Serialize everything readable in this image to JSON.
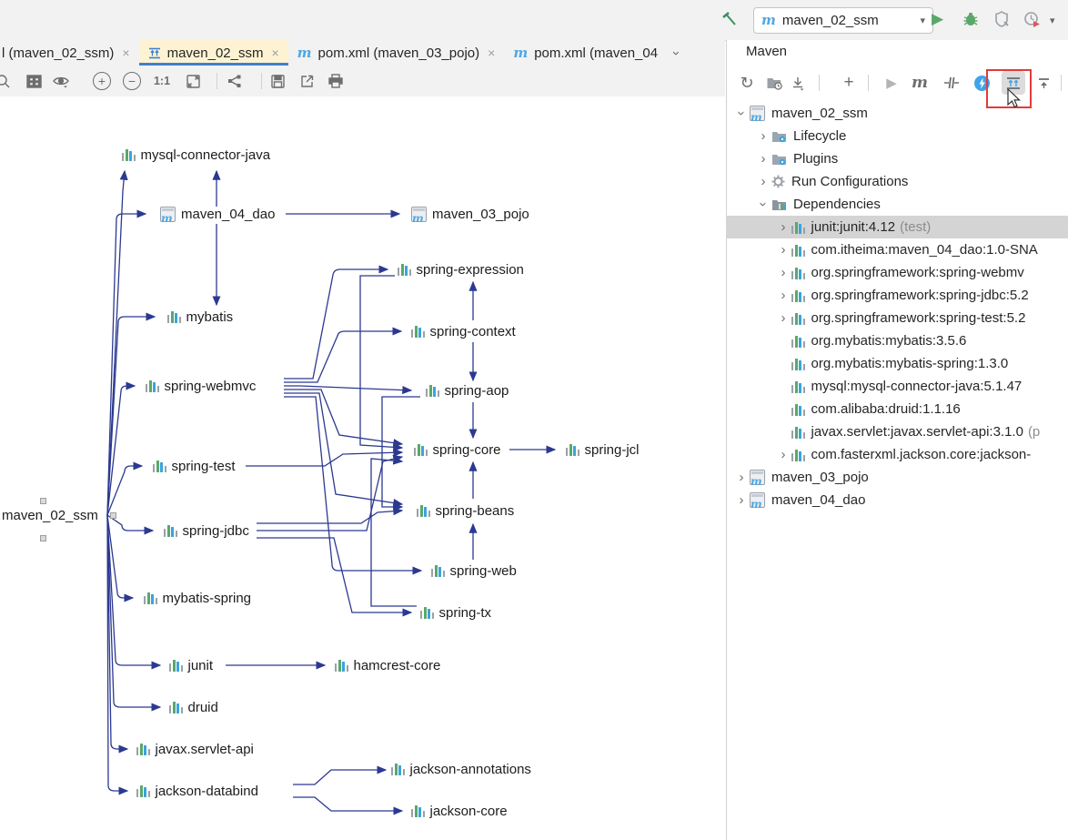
{
  "colors": {
    "accent_blue": "#3f7fd0",
    "active_tab_bg": "#fdf3d3",
    "edge": "#2b3990",
    "selected_row": "#d4d4d4",
    "highlight_red": "#e23b3b",
    "icon_green": "#59a869",
    "maven_blue": "#4fa7e3"
  },
  "glyphs": {
    "close": "×",
    "chevron": "›",
    "dropdown": "▾",
    "plus": "+",
    "minus": "−",
    "run": "▶",
    "refresh": "↻",
    "lightning": "⚡",
    "maven_m": "m",
    "one_to_one": "1:1"
  },
  "top_toolbar": {
    "run_config": "maven_02_ssm"
  },
  "tabs": [
    {
      "label": "l (maven_02_ssm)"
    },
    {
      "label": "maven_02_ssm",
      "active": true
    },
    {
      "label": "pom.xml (maven_03_pojo)"
    },
    {
      "label": "pom.xml (maven_04"
    }
  ],
  "maven_panel": {
    "title": "Maven",
    "tree": [
      {
        "label": "maven_02_ssm"
      },
      {
        "label": "Lifecycle"
      },
      {
        "label": "Plugins"
      },
      {
        "label": "Run Configurations"
      },
      {
        "label": "Dependencies"
      },
      {
        "label": "junit:junit:4.12",
        "suffix": "(test)",
        "selected": true
      },
      {
        "label": "com.itheima:maven_04_dao:1.0-SNA"
      },
      {
        "label": "org.springframework:spring-webmv"
      },
      {
        "label": "org.springframework:spring-jdbc:5.2"
      },
      {
        "label": "org.springframework:spring-test:5.2"
      },
      {
        "label": "org.mybatis:mybatis:3.5.6"
      },
      {
        "label": "org.mybatis:mybatis-spring:1.3.0"
      },
      {
        "label": "mysql:mysql-connector-java:5.1.47"
      },
      {
        "label": "com.alibaba:druid:1.1.16"
      },
      {
        "label": "javax.servlet:javax.servlet-api:3.1.0",
        "suffix": "(p"
      },
      {
        "label": "com.fasterxml.jackson.core:jackson-"
      },
      {
        "label": "maven_03_pojo"
      },
      {
        "label": "maven_04_dao"
      }
    ]
  },
  "diagram": {
    "nodes": [
      {
        "label": "maven_02_ssm"
      },
      {
        "label": "mysql-connector-java"
      },
      {
        "label": "maven_04_dao"
      },
      {
        "label": "maven_03_pojo"
      },
      {
        "label": "mybatis"
      },
      {
        "label": "spring-expression"
      },
      {
        "label": "spring-context"
      },
      {
        "label": "spring-webmvc"
      },
      {
        "label": "spring-aop"
      },
      {
        "label": "spring-core"
      },
      {
        "label": "spring-jcl"
      },
      {
        "label": "spring-test"
      },
      {
        "label": "spring-beans"
      },
      {
        "label": "spring-jdbc"
      },
      {
        "label": "spring-web"
      },
      {
        "label": "mybatis-spring"
      },
      {
        "label": "spring-tx"
      },
      {
        "label": "junit"
      },
      {
        "label": "hamcrest-core"
      },
      {
        "label": "druid"
      },
      {
        "label": "javax.servlet-api"
      },
      {
        "label": "jackson-databind"
      },
      {
        "label": "jackson-annotations"
      },
      {
        "label": "jackson-core"
      }
    ],
    "edges": [
      {
        "from": "maven_02_ssm",
        "to": "mysql-connector-java"
      },
      {
        "from": "maven_02_ssm",
        "to": "maven_04_dao"
      },
      {
        "from": "maven_02_ssm",
        "to": "mybatis"
      },
      {
        "from": "maven_02_ssm",
        "to": "spring-webmvc"
      },
      {
        "from": "maven_02_ssm",
        "to": "spring-test"
      },
      {
        "from": "maven_02_ssm",
        "to": "spring-jdbc"
      },
      {
        "from": "maven_02_ssm",
        "to": "mybatis-spring"
      },
      {
        "from": "maven_02_ssm",
        "to": "junit"
      },
      {
        "from": "maven_02_ssm",
        "to": "druid"
      },
      {
        "from": "maven_02_ssm",
        "to": "javax.servlet-api"
      },
      {
        "from": "maven_02_ssm",
        "to": "jackson-databind"
      },
      {
        "from": "maven_04_dao",
        "to": "mysql-connector-java"
      },
      {
        "from": "maven_04_dao",
        "to": "maven_03_pojo"
      },
      {
        "from": "maven_04_dao",
        "to": "mybatis"
      },
      {
        "from": "spring-context",
        "to": "spring-expression"
      },
      {
        "from": "spring-context",
        "to": "spring-aop"
      },
      {
        "from": "spring-aop",
        "to": "spring-core"
      },
      {
        "from": "spring-beans",
        "to": "spring-core"
      },
      {
        "from": "spring-web",
        "to": "spring-beans"
      },
      {
        "from": "spring-core",
        "to": "spring-jcl"
      },
      {
        "from": "spring-webmvc",
        "to": "spring-expression"
      },
      {
        "from": "spring-webmvc",
        "to": "spring-context"
      },
      {
        "from": "spring-webmvc",
        "to": "spring-aop"
      },
      {
        "from": "spring-webmvc",
        "to": "spring-core"
      },
      {
        "from": "spring-webmvc",
        "to": "spring-beans"
      },
      {
        "from": "spring-webmvc",
        "to": "spring-web"
      },
      {
        "from": "spring-test",
        "to": "spring-core"
      },
      {
        "from": "spring-jdbc",
        "to": "spring-beans"
      },
      {
        "from": "spring-jdbc",
        "to": "spring-core"
      },
      {
        "from": "spring-jdbc",
        "to": "spring-tx"
      },
      {
        "from": "spring-expression",
        "to": "spring-core"
      },
      {
        "from": "spring-aop",
        "to": "spring-beans"
      },
      {
        "from": "spring-tx",
        "to": "spring-core"
      },
      {
        "from": "junit",
        "to": "hamcrest-core"
      },
      {
        "from": "jackson-databind",
        "to": "jackson-annotations"
      },
      {
        "from": "jackson-databind",
        "to": "jackson-core"
      }
    ]
  }
}
